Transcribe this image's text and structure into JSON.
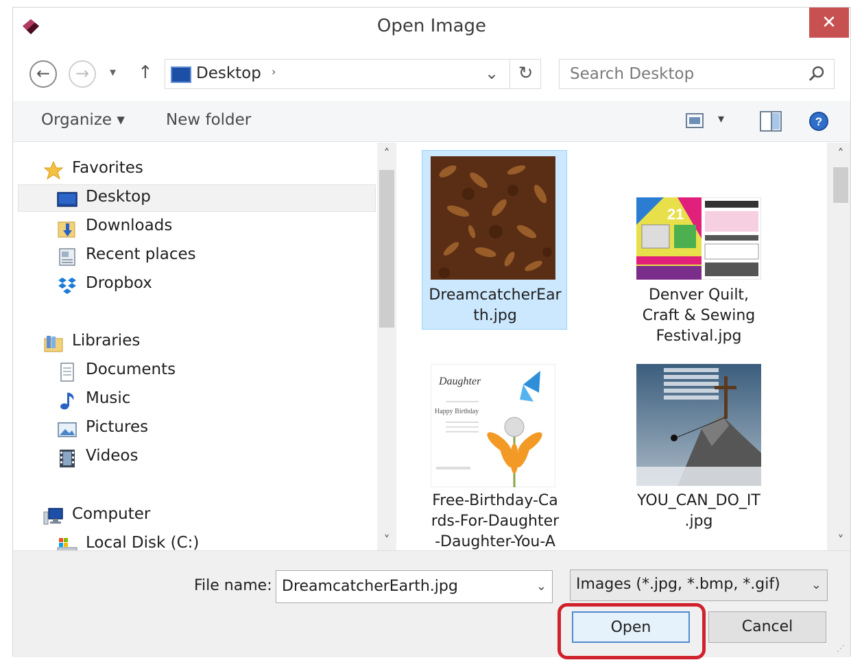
{
  "window": {
    "title": "Open Image",
    "close_glyph": "✕",
    "icon": "app-gem-icon"
  },
  "address_bar": {
    "back_glyph": "←",
    "forward_glyph": "→",
    "recent_glyph": "▾",
    "up_glyph": "↑",
    "location": "Desktop",
    "chevron": "›",
    "dropdown_glyph": "⌄",
    "refresh_glyph": "↻"
  },
  "search": {
    "placeholder": "Search Desktop",
    "icon": "search-icon"
  },
  "command_bar": {
    "organize_label": "Organize ▾",
    "new_folder_label": "New folder",
    "view_dropdown_glyph": "▾"
  },
  "navigation": {
    "favorites_label": "Favorites",
    "favorites_items": [
      "Desktop",
      "Downloads",
      "Recent places",
      "Dropbox"
    ],
    "libraries_label": "Libraries",
    "libraries_items": [
      "Documents",
      "Music",
      "Pictures",
      "Videos"
    ],
    "computer_label": "Computer",
    "computer_items": [
      "Local Disk (C:)"
    ],
    "selected": "Desktop",
    "scroll_up": "˄",
    "scroll_down": "˅"
  },
  "files": {
    "items": [
      {
        "name_line1": "DreamcatcherEar",
        "name_line2": "th.jpg",
        "name_line3": "",
        "selected": true
      },
      {
        "name_line1": "Denver Quilt,",
        "name_line2": "Craft & Sewing",
        "name_line3": "Festival.jpg",
        "selected": false
      },
      {
        "name_line1": "Free-Birthday-Ca",
        "name_line2": "rds-For-Daughter",
        "name_line3": "-Daughter-You-A",
        "selected": false
      },
      {
        "name_line1": "YOU_CAN_DO_IT",
        "name_line2": ".jpg",
        "name_line3": "",
        "selected": false
      }
    ],
    "quilt_poster_text": "21",
    "birthday_card_title": "Daughter",
    "birthday_card_text": "Happy Birthday",
    "scroll_up": "˄",
    "scroll_down": "˅"
  },
  "bottom": {
    "file_name_label": "File name:",
    "file_name_value": "DreamcatcherEarth.jpg",
    "file_name_dropdown": "⌄",
    "filter_value": "Images (*.jpg, *.bmp, *.gif)",
    "filter_dropdown": "⌄",
    "open_label": "Open",
    "cancel_label": "Cancel",
    "grip": "⋰"
  },
  "colors": {
    "close_button": "#c75050",
    "selection_fill": "#cce8ff",
    "selection_border": "#99d1ff",
    "highlight_annotation": "#d0222d",
    "open_button_border": "#4f8bd1"
  }
}
